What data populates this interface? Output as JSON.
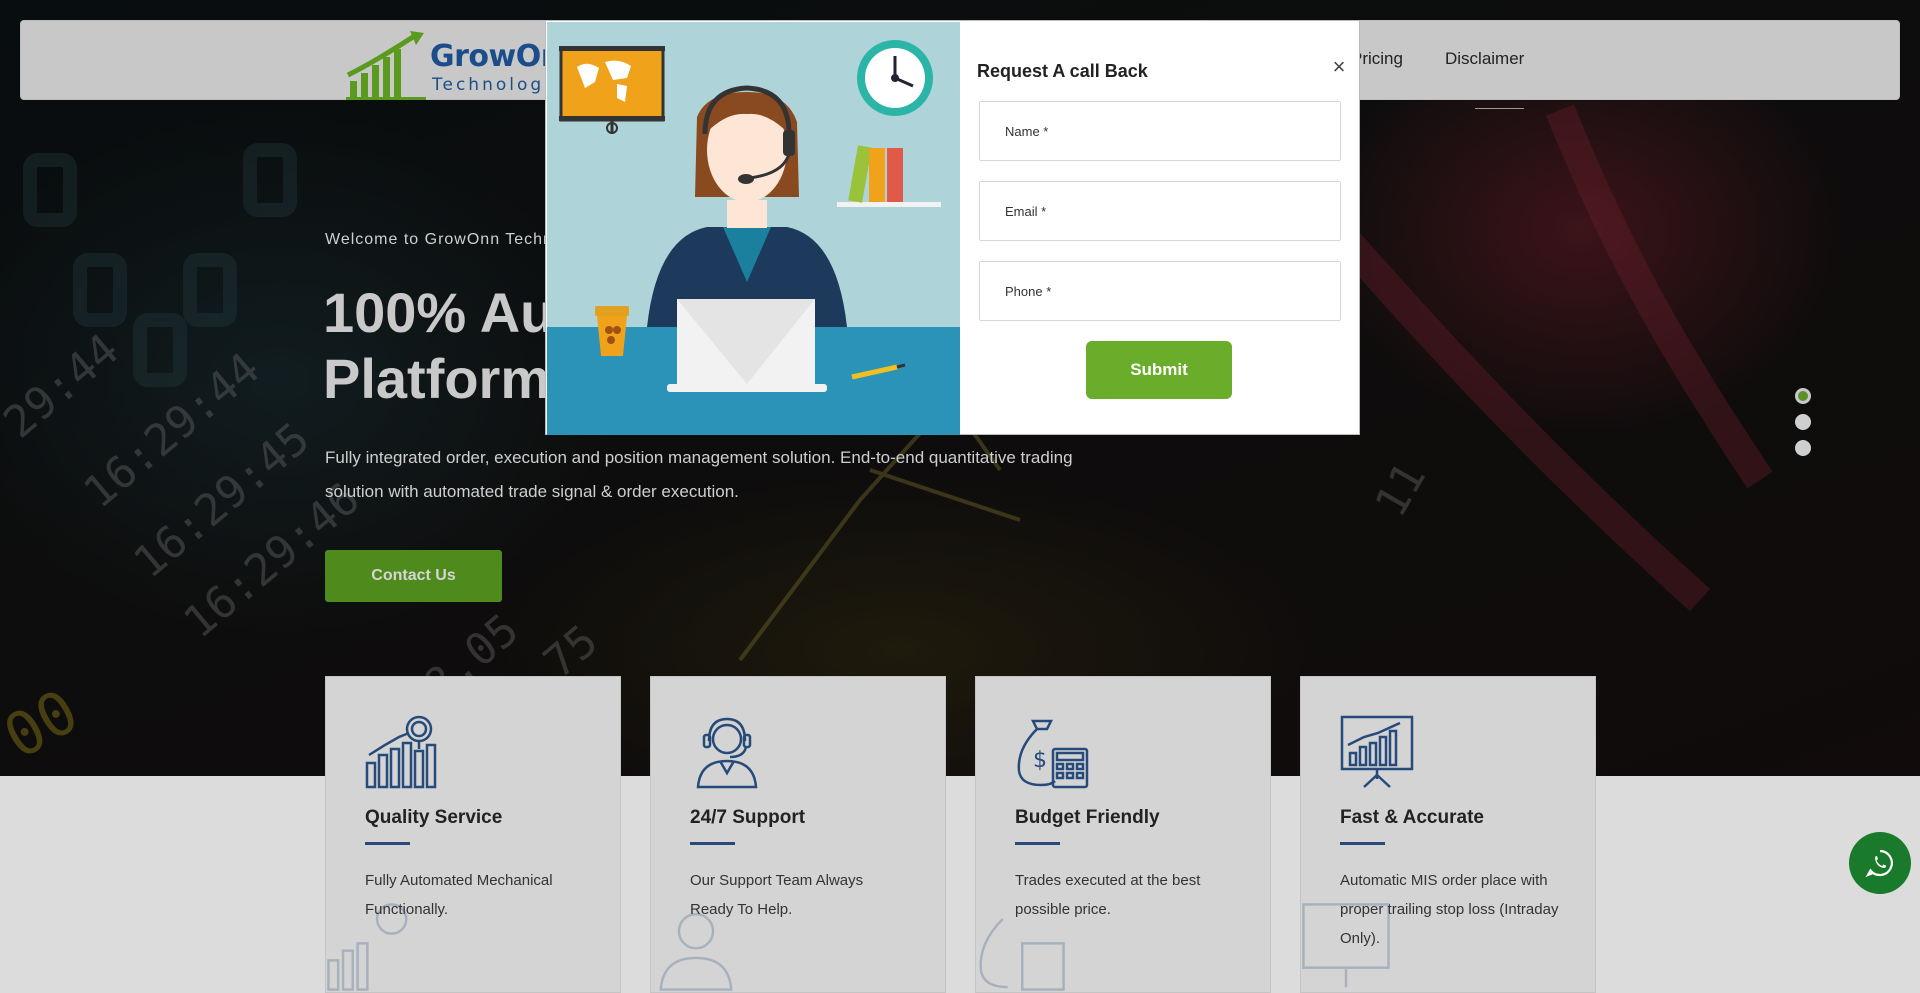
{
  "navbar": {
    "logo_line1": "GrowOnn",
    "logo_line2": "Technologies",
    "links": [
      "Pricing",
      "Disclaimer"
    ]
  },
  "hero": {
    "welcome": "Welcome to GrowOnn Techn",
    "title_line1": "100% Au",
    "title_line2": "Platform",
    "description": "Fully integrated order, execution and position management solution. End-to-end quantitative trading solution with automated trade signal & order execution.",
    "cta_label": "Contact Us",
    "slider_dots": 3,
    "active_dot": 0
  },
  "features": [
    {
      "title": "Quality Service",
      "description": "Fully Automated Mechanical Functionally.",
      "icon": "growth-chart-icon"
    },
    {
      "title": "24/7 Support",
      "description": "Our Support Team Always Ready To Help.",
      "icon": "headset-agent-icon"
    },
    {
      "title": "Budget Friendly",
      "description": "Trades executed at the best possible price.",
      "icon": "money-bag-calculator-icon"
    },
    {
      "title": "Fast & Accurate",
      "description": "Automatic MIS order place with proper trailing stop loss (Intraday Only).",
      "icon": "presentation-chart-icon"
    }
  ],
  "modal": {
    "title": "Request A call Back",
    "close_symbol": "×",
    "name_placeholder": "Name *",
    "email_placeholder": "Email *",
    "phone_placeholder": "Phone *",
    "submit_label": "Submit"
  },
  "colors": {
    "accent_green": "#6aad2a",
    "brand_blue": "#1a4d8a",
    "whatsapp_green": "#1a7a2c"
  }
}
